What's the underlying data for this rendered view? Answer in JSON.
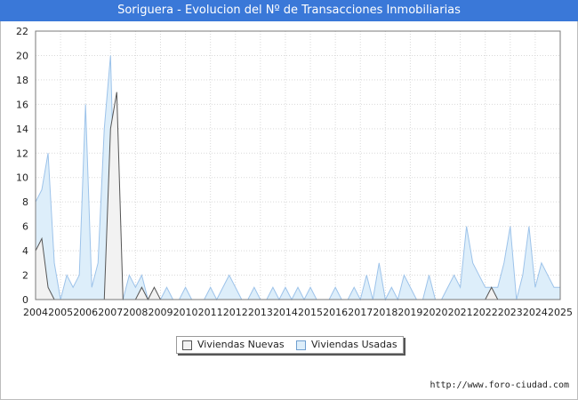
{
  "header": {
    "title": "Soriguera - Evolucion del Nº de Transacciones Inmobiliarias"
  },
  "footer": {
    "url": "http://www.foro-ciudad.com"
  },
  "chart_data": {
    "type": "area",
    "title": "Soriguera - Evolucion del Nº de Transacciones Inmobiliarias",
    "xlabel": "",
    "ylabel": "",
    "ylim": [
      0,
      22
    ],
    "y_ticks": [
      0,
      2,
      4,
      6,
      8,
      10,
      12,
      14,
      16,
      18,
      20,
      22
    ],
    "x_ticks": [
      "2004",
      "2005",
      "2006",
      "2007",
      "2008",
      "2009",
      "2010",
      "2011",
      "2012",
      "2013",
      "2014",
      "2015",
      "2016",
      "2017",
      "2018",
      "2019",
      "2020",
      "2021",
      "2022",
      "2023",
      "2024",
      "2025"
    ],
    "grid": true,
    "legend_position": "bottom",
    "periods_per_year": 4,
    "series": [
      {
        "name": "Viviendas Nuevas",
        "color": "#555555",
        "fill": "#f2f2f2",
        "values": [
          4,
          5,
          1,
          0,
          0,
          0,
          0,
          0,
          0,
          0,
          0,
          0,
          14,
          17,
          0,
          0,
          0,
          1,
          0,
          1,
          0,
          0,
          0,
          0,
          0,
          0,
          0,
          0,
          0,
          0,
          0,
          0,
          0,
          0,
          0,
          0,
          0,
          0,
          0,
          0,
          0,
          0,
          0,
          0,
          0,
          0,
          0,
          0,
          0,
          0,
          0,
          0,
          0,
          0,
          0,
          0,
          0,
          0,
          0,
          0,
          0,
          0,
          0,
          0,
          0,
          0,
          0,
          0,
          0,
          0,
          0,
          0,
          0,
          1,
          0,
          0,
          0,
          0,
          0,
          0,
          0,
          0,
          0,
          0,
          0
        ]
      },
      {
        "name": "Viviendas Usadas",
        "color": "#9dc3ea",
        "fill": "#ddeefa",
        "values": [
          8,
          9,
          12,
          3,
          0,
          2,
          1,
          2,
          16,
          1,
          3,
          14,
          20,
          1,
          0,
          2,
          1,
          2,
          0,
          0,
          0,
          1,
          0,
          0,
          1,
          0,
          0,
          0,
          1,
          0,
          1,
          2,
          1,
          0,
          0,
          1,
          0,
          0,
          1,
          0,
          1,
          0,
          1,
          0,
          1,
          0,
          0,
          0,
          1,
          0,
          0,
          1,
          0,
          2,
          0,
          3,
          0,
          1,
          0,
          2,
          1,
          0,
          0,
          2,
          0,
          0,
          1,
          2,
          1,
          6,
          3,
          2,
          1,
          1,
          1,
          3,
          6,
          0,
          2,
          6,
          1,
          3,
          2,
          1,
          1
        ]
      }
    ]
  }
}
